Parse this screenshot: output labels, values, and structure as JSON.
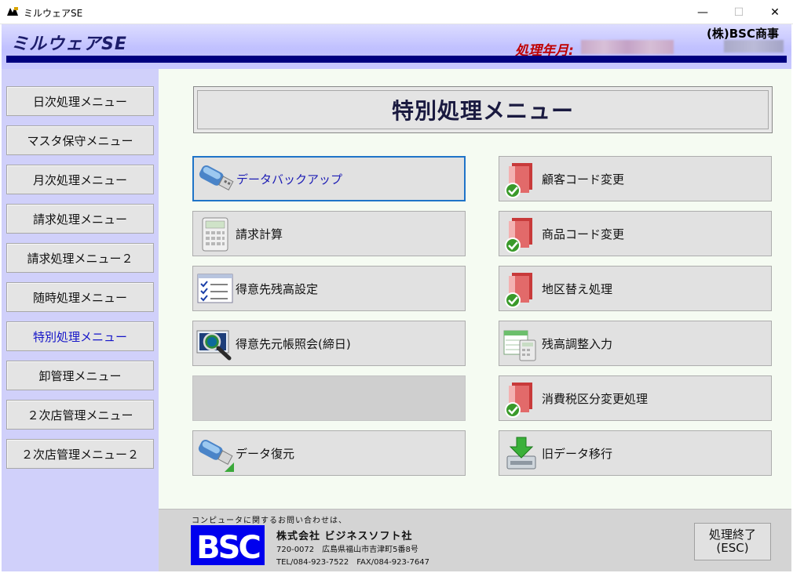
{
  "window": {
    "title": "ミルウェアSE",
    "minimize": "—",
    "maximize": "☐",
    "close": "✕"
  },
  "header": {
    "brand": "ミルウェアSE",
    "processing_label": "処理年月:",
    "company": "(株)BSC商事"
  },
  "sidebar": {
    "items": [
      {
        "label": "日次処理メニュー",
        "active": false
      },
      {
        "label": "マスタ保守メニュー",
        "active": false
      },
      {
        "label": "月次処理メニュー",
        "active": false
      },
      {
        "label": "請求処理メニュー",
        "active": false
      },
      {
        "label": "請求処理メニュー２",
        "active": false
      },
      {
        "label": "随時処理メニュー",
        "active": false
      },
      {
        "label": "特別処理メニュー",
        "active": true
      },
      {
        "label": "卸管理メニュー",
        "active": false
      },
      {
        "label": "２次店管理メニュー",
        "active": false
      },
      {
        "label": "２次店管理メニュー２",
        "active": false
      }
    ]
  },
  "main": {
    "title": "特別処理メニュー",
    "left_buttons": [
      {
        "label": "データバックアップ",
        "icon": "usb-drive-icon"
      },
      {
        "label": "請求計算",
        "icon": "calculator-icon"
      },
      {
        "label": "得意先残高設定",
        "icon": "checklist-icon"
      },
      {
        "label": "得意先元帳照会(締日)",
        "icon": "magnifier-icon"
      },
      {
        "label": "",
        "icon": ""
      },
      {
        "label": "データ復元",
        "icon": "usb-restore-icon"
      }
    ],
    "right_buttons": [
      {
        "label": "顧客コード変更",
        "icon": "doc-check-icon"
      },
      {
        "label": "商品コード変更",
        "icon": "doc-check-icon"
      },
      {
        "label": "地区替え処理",
        "icon": "doc-check-icon"
      },
      {
        "label": "残高調整入力",
        "icon": "ledger-calculator-icon"
      },
      {
        "label": "消費税区分変更処理",
        "icon": "doc-check-icon"
      },
      {
        "label": "旧データ移行",
        "icon": "download-drive-icon"
      }
    ]
  },
  "footer": {
    "note": "コンピュータに関するお問い合わせは、",
    "logo_text": "BSC",
    "corp": "株式会社 ビジネスソフト社",
    "address": "720-0072　広島県福山市吉津町5番8号",
    "tel": "TEL/084-923-7522　FAX/084-923-7647",
    "exit_label_1": "処理終了",
    "exit_label_2": "(ESC)"
  },
  "colors": {
    "header_accent": "#000080",
    "sidebar_bg": "#d0d0fa",
    "active_text": "#1414c8",
    "focus_border": "#1f74c8",
    "processing_label": "#c00000",
    "logo_bg": "#0000ee"
  }
}
